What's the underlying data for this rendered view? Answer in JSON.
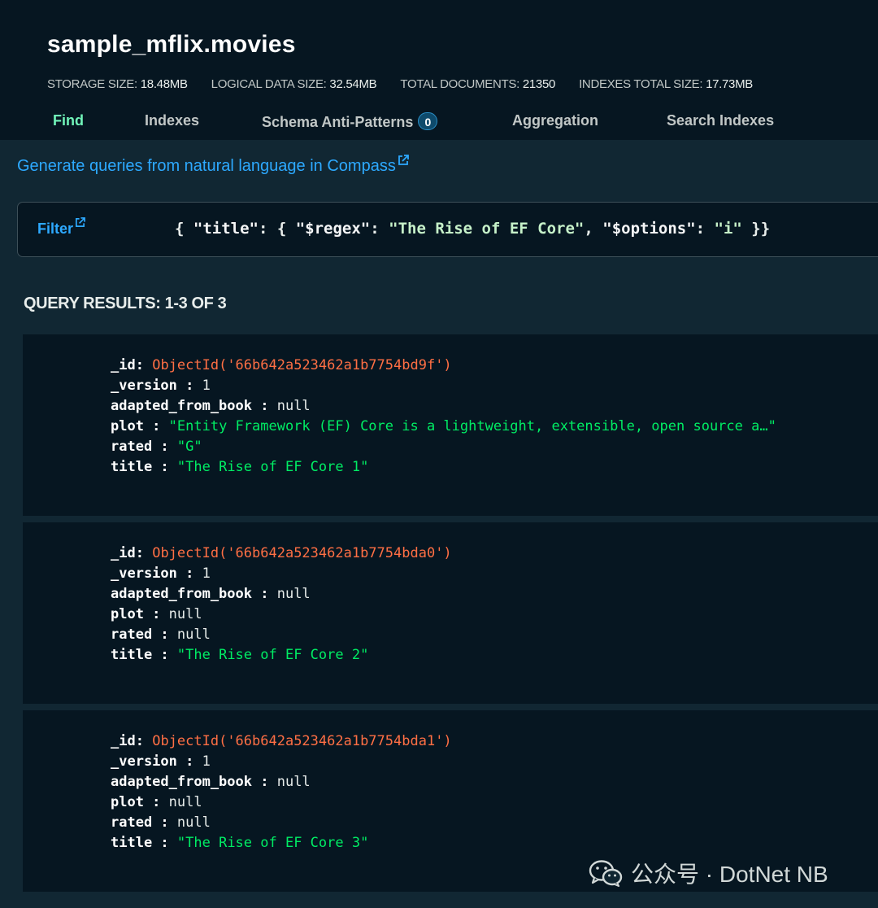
{
  "collection": {
    "title": "sample_mflix.movies",
    "stats": [
      {
        "label": "STORAGE SIZE:",
        "value": "18.48MB"
      },
      {
        "label": "LOGICAL DATA SIZE:",
        "value": "32.54MB"
      },
      {
        "label": "TOTAL DOCUMENTS:",
        "value": "21350"
      },
      {
        "label": "INDEXES TOTAL SIZE:",
        "value": "17.73MB"
      }
    ]
  },
  "tabs": [
    {
      "label": "Find",
      "active": true
    },
    {
      "label": "Indexes"
    },
    {
      "label": "Schema Anti-Patterns",
      "badge": "0"
    },
    {
      "label": "Aggregation"
    },
    {
      "label": "Search Indexes"
    }
  ],
  "nl_link": "Generate queries from natural language in Compass",
  "filter": {
    "label": "Filter",
    "query_parts": [
      "{ ",
      "\"title\"",
      ": { ",
      "\"$regex\"",
      ": ",
      "\"The Rise of EF Core\"",
      ", ",
      "\"$options\"",
      ": ",
      "\"i\"",
      " }}"
    ]
  },
  "results": {
    "label": "QUERY RESULTS: 1-3 OF 3",
    "documents": [
      {
        "id": "ObjectId('66b642a523462a1b7754bd9f')",
        "version": "1",
        "adapted_from_book": "null",
        "plot": "\"Entity Framework (EF) Core is a lightweight, extensible, open source a…\"",
        "rated": "\"G\"",
        "title": "\"The Rise of EF Core 1\""
      },
      {
        "id": "ObjectId('66b642a523462a1b7754bda0')",
        "version": "1",
        "adapted_from_book": "null",
        "plot": "null",
        "rated": "null",
        "title": "\"The Rise of EF Core 2\""
      },
      {
        "id": "ObjectId('66b642a523462a1b7754bda1')",
        "version": "1",
        "adapted_from_book": "null",
        "plot": "null",
        "rated": "null",
        "title": "\"The Rise of EF Core 3\""
      }
    ],
    "field_names": {
      "id": "_id:",
      "version": "_version :",
      "adapted_from_book": "adapted_from_book :",
      "plot": "plot :",
      "rated": "rated :",
      "title": "title :"
    }
  },
  "watermark": "公众号 · DotNet NB",
  "colors": {
    "accent_green": "#71f6ba",
    "link_blue": "#2da9ff",
    "objectid_red": "#ff6f44",
    "string_green": "#00ed64"
  }
}
